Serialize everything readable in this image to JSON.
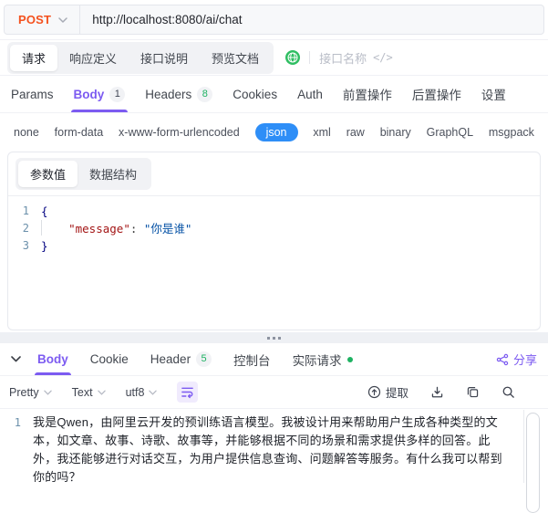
{
  "colors": {
    "accent_purple": "#7c5bf1",
    "method_orange": "#f4511e",
    "json_blue": "#2e8ef7",
    "green": "#1eb262"
  },
  "request_bar": {
    "method": "POST",
    "url": "http://localhost:8080/ai/chat"
  },
  "doc_tabs": {
    "tabs": [
      "请求",
      "响应定义",
      "接口说明",
      "预览文档"
    ],
    "name_placeholder": "接口名称",
    "code_glyph": "</>"
  },
  "request_tabs": {
    "params": "Params",
    "body": "Body",
    "body_count": "1",
    "headers": "Headers",
    "headers_count": "8",
    "cookies": "Cookies",
    "auth": "Auth",
    "pre_ops": "前置操作",
    "post_ops": "后置操作",
    "settings": "设置"
  },
  "body_types": {
    "none": "none",
    "form_data": "form-data",
    "urlencoded": "x-www-form-urlencoded",
    "json": "json",
    "xml": "xml",
    "raw": "raw",
    "binary": "binary",
    "graphql": "GraphQL",
    "msgpack": "msgpack"
  },
  "body_view": {
    "param_value": "参数值",
    "data_schema": "数据结构"
  },
  "request_editor": {
    "line1_num": "1",
    "line2_num": "2",
    "line3_num": "3",
    "open_brace": "{",
    "indent": "    ",
    "key": "\"message\"",
    "separator": ": ",
    "value": "\"你是谁\"",
    "close_brace": "}"
  },
  "response_tabs": {
    "body": "Body",
    "cookie": "Cookie",
    "header": "Header",
    "header_count": "5",
    "console": "控制台",
    "actual_request": "实际请求",
    "share": "分享"
  },
  "response_toolbar": {
    "pretty": "Pretty",
    "format": "Text",
    "encoding": "utf8",
    "extract": "提取"
  },
  "response_body": {
    "line_num": "1",
    "text": "我是Qwen，由阿里云开发的预训练语言模型。我被设计用来帮助用户生成各种类型的文本，如文章、故事、诗歌、故事等，并能够根据不同的场景和需求提供多样的回答。此外，我还能够进行对话交互，为用户提供信息查询、问题解答等服务。有什么我可以帮到你的吗？"
  }
}
